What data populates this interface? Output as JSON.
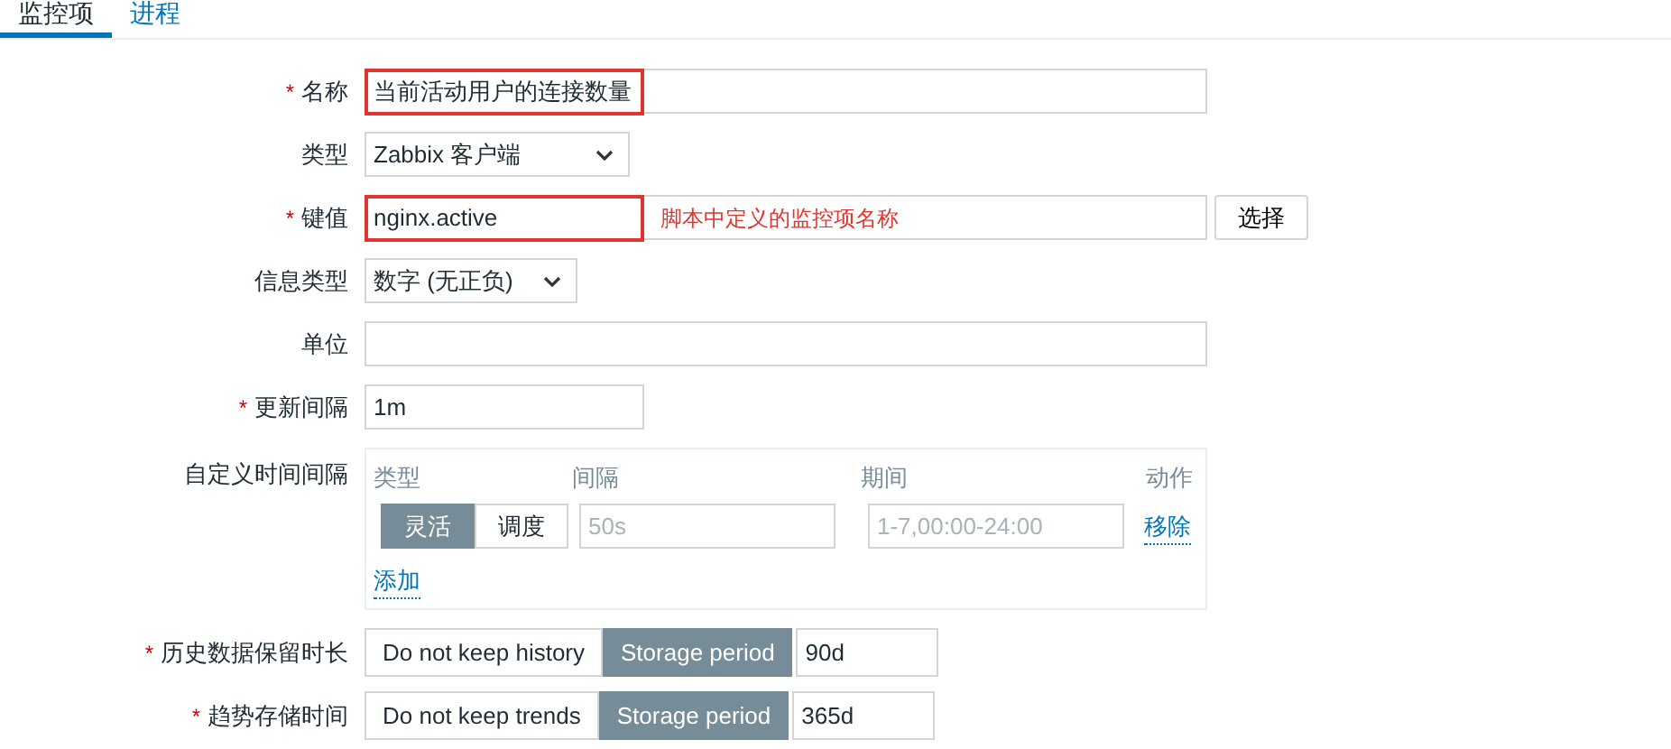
{
  "tabs": [
    {
      "label": "监控项",
      "selected": true
    },
    {
      "label": "进程",
      "selected": false
    }
  ],
  "fields": [
    {
      "kind": "text",
      "marker": "*",
      "label": "名称",
      "value": "当前活动用户的连接数量",
      "highlighted": true
    },
    {
      "kind": "select",
      "label": "类型",
      "value": "Zabbix 客户端"
    },
    {
      "kind": "text",
      "marker": "*",
      "label": "键值",
      "value": "nginx.active",
      "highlighted": true,
      "note": "脚本中定义的监控项名称",
      "button": "选择"
    },
    {
      "kind": "select",
      "label": "信息类型",
      "value": "数字 (无正负)"
    },
    {
      "kind": "text",
      "label": "单位",
      "highlighted": false
    },
    {
      "kind": "text",
      "marker": "*",
      "label": "更新间隔",
      "value": "1m",
      "highlighted": false
    },
    {
      "kind": "intervals",
      "label": "自定义时间间隔",
      "columns": [
        "类型",
        "间隔",
        "期间",
        "动作"
      ],
      "rows": [
        {
          "modes": [
            {
              "label": "灵活",
              "selected": true
            },
            {
              "label": "调度",
              "selected": false
            }
          ],
          "interval_placeholder": "50s",
          "period_placeholder": "1-7,00:00-24:00",
          "action": "移除"
        }
      ],
      "add": "添加"
    },
    {
      "kind": "storage",
      "marker": "*",
      "label": "历史数据保留时长",
      "options": [
        {
          "label": "Do not keep history",
          "selected": false
        },
        {
          "label": "Storage period",
          "selected": true
        }
      ],
      "value": "90d"
    },
    {
      "kind": "storage",
      "marker": "*",
      "label": "趋势存储时间",
      "options": [
        {
          "label": "Do not keep trends",
          "selected": false
        },
        {
          "label": "Storage period",
          "selected": true
        }
      ],
      "value": "365d"
    }
  ]
}
